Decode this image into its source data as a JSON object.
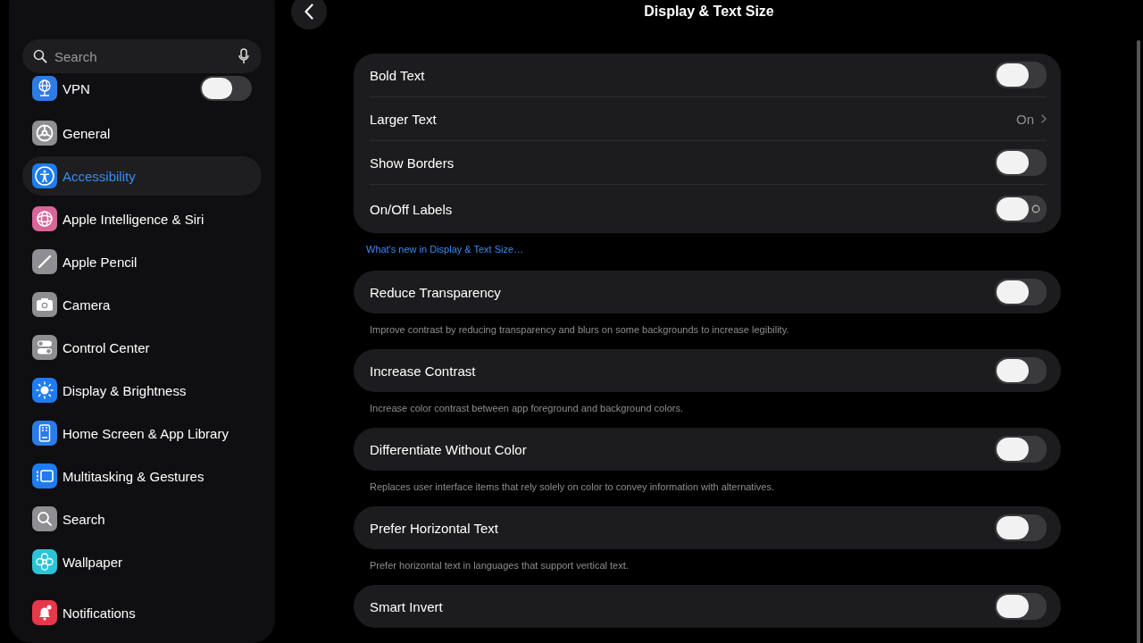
{
  "sidebar": {
    "search": {
      "placeholder": "Search"
    },
    "groups": [
      {
        "items": [
          {
            "kind": "toggle",
            "label": "VPN",
            "color": "#2f7be5",
            "selected": false,
            "on": false
          }
        ]
      },
      {
        "items": [
          {
            "kind": "link",
            "label": "General",
            "color": "#8e8e93",
            "selected": false
          },
          {
            "kind": "link",
            "label": "Accessibility",
            "color": "#1e7cf0",
            "selected": true
          },
          {
            "kind": "link",
            "label": "Apple Intelligence & Siri",
            "color": "#d9669a",
            "selected": false
          },
          {
            "kind": "link",
            "label": "Apple Pencil",
            "color": "#8e8e93",
            "selected": false
          },
          {
            "kind": "link",
            "label": "Camera",
            "color": "#8e8e93",
            "selected": false
          },
          {
            "kind": "link",
            "label": "Control Center",
            "color": "#8e8e93",
            "selected": false
          },
          {
            "kind": "link",
            "label": "Display & Brightness",
            "color": "#1e7cf0",
            "selected": false
          },
          {
            "kind": "link",
            "label": "Home Screen & App Library",
            "color": "#2a7de8",
            "selected": false
          },
          {
            "kind": "link",
            "label": "Multitasking & Gestures",
            "color": "#1e7cf0",
            "selected": false
          },
          {
            "kind": "link",
            "label": "Search",
            "color": "#8e8e93",
            "selected": false
          },
          {
            "kind": "link",
            "label": "Wallpaper",
            "color": "#2cc3d6",
            "selected": false
          }
        ]
      },
      {
        "items": [
          {
            "kind": "link",
            "label": "Notifications",
            "color": "#e5384a",
            "selected": false
          }
        ]
      }
    ]
  },
  "page": {
    "title": "Display & Text Size",
    "groups": [
      {
        "rows": [
          {
            "kind": "toggle",
            "label": "Bold Text",
            "on": false,
            "off_label": false
          },
          {
            "kind": "link",
            "label": "Larger Text",
            "value": "On"
          },
          {
            "kind": "toggle",
            "label": "Show Borders",
            "on": false,
            "off_label": false
          },
          {
            "kind": "toggle",
            "label": "On/Off Labels",
            "on": false,
            "off_label": true
          }
        ],
        "footer": {
          "kind": "link",
          "text": "What's new in Display & Text Size…"
        }
      },
      {
        "rows": [
          {
            "kind": "toggle",
            "label": "Reduce Transparency",
            "on": false,
            "off_label": false
          }
        ],
        "footer": {
          "kind": "note",
          "text": "Improve contrast by reducing transparency and blurs on some backgrounds to increase legibility."
        }
      },
      {
        "rows": [
          {
            "kind": "toggle",
            "label": "Increase Contrast",
            "on": false,
            "off_label": false
          }
        ],
        "footer": {
          "kind": "note",
          "text": "Increase color contrast between app foreground and background colors."
        }
      },
      {
        "rows": [
          {
            "kind": "toggle",
            "label": "Differentiate Without Color",
            "on": false,
            "off_label": false
          }
        ],
        "footer": {
          "kind": "note",
          "text": "Replaces user interface items that rely solely on color to convey information with alternatives."
        }
      },
      {
        "rows": [
          {
            "kind": "toggle",
            "label": "Prefer Horizontal Text",
            "on": false,
            "off_label": false
          }
        ],
        "footer": {
          "kind": "note",
          "text": "Prefer horizontal text in languages that support vertical text."
        }
      },
      {
        "rows": [
          {
            "kind": "toggle",
            "label": "Smart Invert",
            "on": false,
            "off_label": false
          }
        ]
      }
    ]
  }
}
